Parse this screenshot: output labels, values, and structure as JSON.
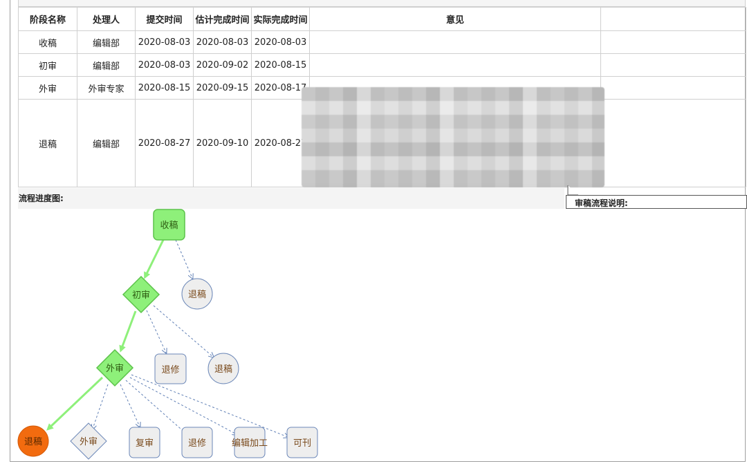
{
  "table": {
    "headers": [
      "阶段名称",
      "处理人",
      "提交时间",
      "估计完成时间",
      "实际完成时间",
      "意见"
    ],
    "rows": [
      {
        "stage": "收稿",
        "handler": "编辑部",
        "submitted": "2020-08-03",
        "estimated": "2020-08-03",
        "actual": "2020-08-03"
      },
      {
        "stage": "初审",
        "handler": "编辑部",
        "submitted": "2020-08-03",
        "estimated": "2020-09-02",
        "actual": "2020-08-15"
      },
      {
        "stage": "外审",
        "handler": "外审专家",
        "submitted": "2020-08-15",
        "estimated": "2020-09-15",
        "actual": "2020-08-17"
      },
      {
        "stage": "退稿",
        "handler": "编辑部",
        "submitted": "2020-08-27",
        "estimated": "2020-09-10",
        "actual": "2020-08-27"
      }
    ]
  },
  "flow": {
    "label": "流程进度图:",
    "tooltip": "审稿流程说明:",
    "nodes": {
      "received": "收稿",
      "initial_review": "初审",
      "reject_1": "退稿",
      "revise_1": "退修",
      "reject_2": "退稿",
      "external_review": "外审",
      "final_reject": "退稿",
      "external_review_2": "外审",
      "re_review": "复审",
      "revise_2": "退修",
      "editing": "编辑加工",
      "publishable": "可刊"
    }
  },
  "colors": {
    "completed_fill": "#8ef07a",
    "completed_stroke": "#5cc24a",
    "current_fill": "#f26b0f",
    "pending_fill": "#eeeeee",
    "pending_stroke": "#6b87b8",
    "active_edge": "#8ef07a",
    "pending_edge": "#5f7fb5"
  }
}
